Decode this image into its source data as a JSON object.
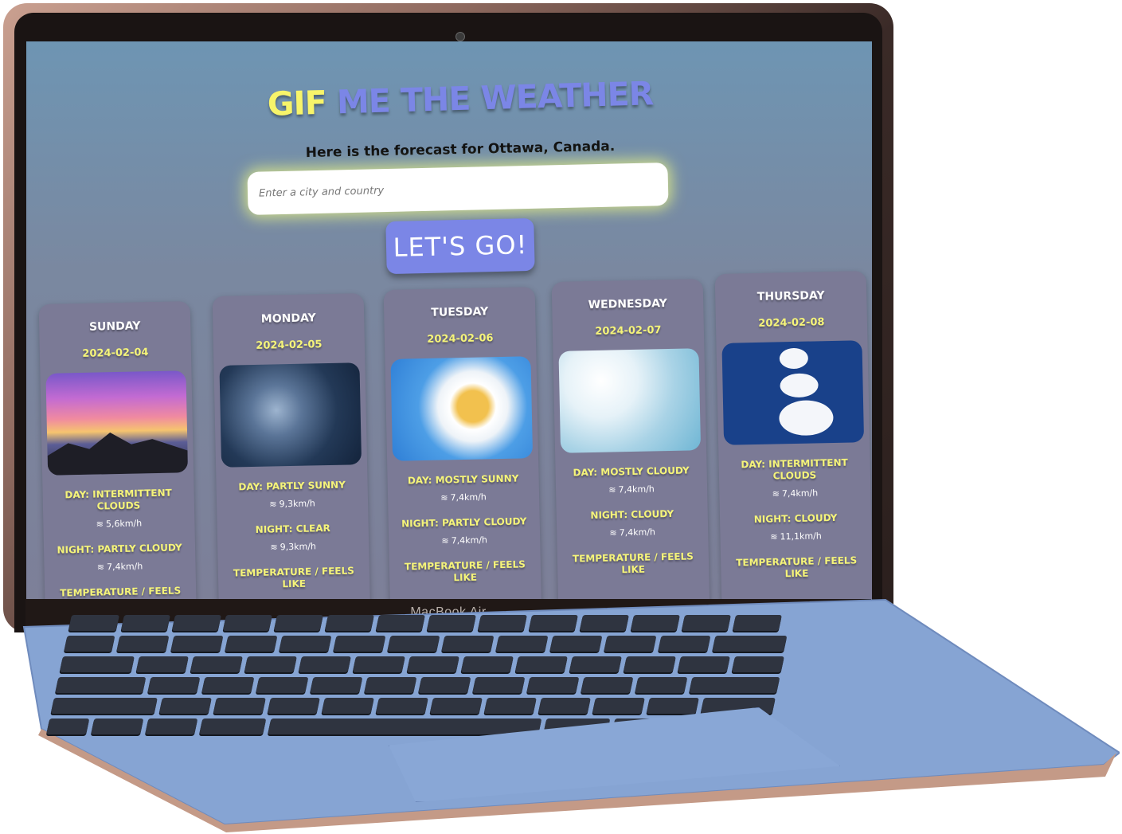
{
  "device": {
    "brand_label": "MacBook Air"
  },
  "app": {
    "title_highlight": "GIF",
    "title_rest": " ME THE WEATHER",
    "subtitle": "Here is the forecast for Ottawa, Canada.",
    "search": {
      "placeholder": "Enter a city and country",
      "value": ""
    },
    "submit_label": "LET'S GO!",
    "colors": {
      "accent": "#7b86e6",
      "highlight": "#f5f47a",
      "card_bg": "#7b7a96"
    }
  },
  "forecast": [
    {
      "day": "SUNDAY",
      "date": "2024-02-04",
      "image": "sunset-mountains",
      "day_label": "DAY: INTERMITTENT CLOUDS",
      "day_wind": "5,6km/h",
      "night_label": "NIGHT: PARTLY CLOUDY",
      "night_wind": "7,4km/h",
      "temp_label": "TEMPERATURE / FEELS LIKE"
    },
    {
      "day": "MONDAY",
      "date": "2024-02-05",
      "image": "night-clouds",
      "day_label": "DAY: PARTLY SUNNY",
      "day_wind": "9,3km/h",
      "night_label": "NIGHT: CLEAR",
      "night_wind": "9,3km/h",
      "temp_label": "TEMPERATURE / FEELS LIKE"
    },
    {
      "day": "TUESDAY",
      "date": "2024-02-06",
      "image": "sun-behind-clouds",
      "day_label": "DAY: MOSTLY SUNNY",
      "day_wind": "7,4km/h",
      "night_label": "NIGHT: PARTLY CLOUDY",
      "night_wind": "7,4km/h",
      "temp_label": "TEMPERATURE / FEELS LIKE"
    },
    {
      "day": "WEDNESDAY",
      "date": "2024-02-07",
      "image": "fluffy-clouds",
      "day_label": "DAY: MOSTLY CLOUDY",
      "day_wind": "7,4km/h",
      "night_label": "NIGHT: CLOUDY",
      "night_wind": "7,4km/h",
      "temp_label": "TEMPERATURE / FEELS LIKE"
    },
    {
      "day": "THURSDAY",
      "date": "2024-02-08",
      "image": "cloud-puffs",
      "day_label": "DAY: INTERMITTENT CLOUDS",
      "day_wind": "7,4km/h",
      "night_label": "NIGHT: CLOUDY",
      "night_wind": "11,1km/h",
      "temp_label": "TEMPERATURE / FEELS LIKE"
    }
  ],
  "icons": {
    "wind": "wind-icon"
  }
}
